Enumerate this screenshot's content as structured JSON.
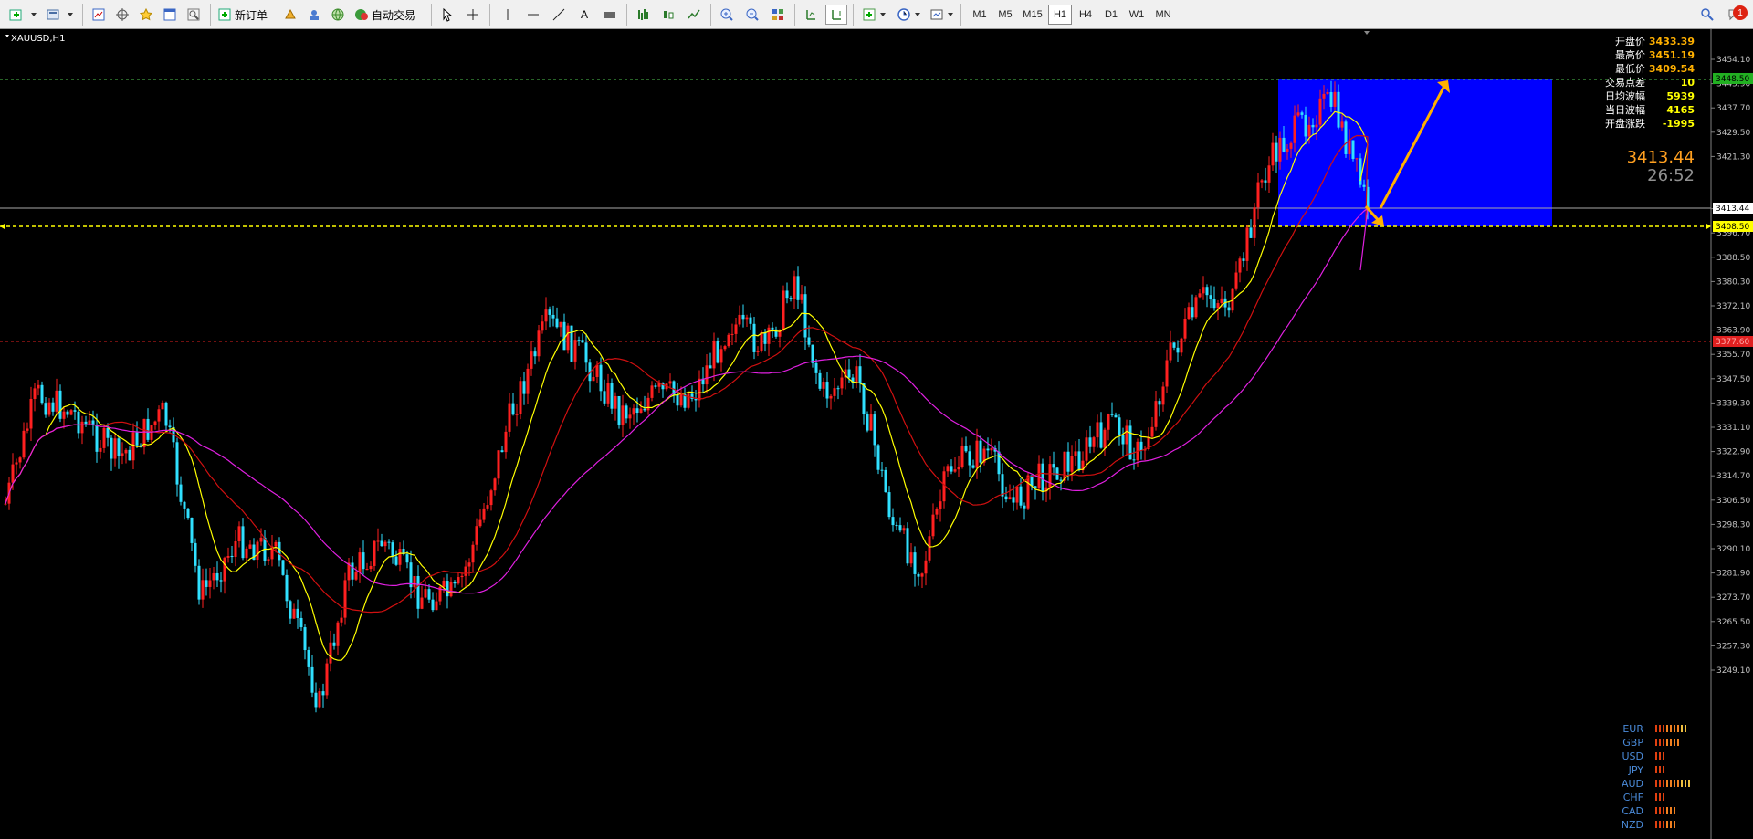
{
  "toolbar": {
    "new_order": "新订单",
    "auto_trade": "自动交易",
    "timeframes": [
      "M1",
      "M5",
      "M15",
      "H1",
      "H4",
      "D1",
      "W1",
      "MN"
    ],
    "active_timeframe": "H1",
    "notification_count": "1"
  },
  "chart": {
    "symbol_label": "XAUUSD,H1",
    "price_axis_ticks": [
      "3454.10",
      "3445.90",
      "3437.70",
      "3429.50",
      "3421.30",
      "3413.44",
      "3404.90",
      "3396.70",
      "3388.50",
      "3380.30",
      "3372.10",
      "3363.90",
      "3355.70",
      "3347.50",
      "3339.30",
      "3331.10",
      "3322.90",
      "3314.70",
      "3306.50",
      "3298.30",
      "3290.10",
      "3281.90",
      "3273.70",
      "3265.50",
      "3257.30",
      "3249.10"
    ],
    "level_labels": {
      "top": "3448.50",
      "current": "3413.44",
      "support": "3408.50",
      "red": "3377.60"
    },
    "colors": {
      "candle_up": "#ff2020",
      "candle_down": "#30e0ff",
      "ma_yellow": "#ffff00",
      "ma_red": "#d01010",
      "ma_magenta": "#e020e0",
      "box": "#0000ff",
      "arrow": "#ffb000"
    }
  },
  "info_panel": {
    "rows": [
      {
        "label": "开盘价",
        "value": "3433.39"
      },
      {
        "label": "最高价",
        "value": "3451.19"
      },
      {
        "label": "最低价",
        "value": "3409.54"
      },
      {
        "label": "交易点差",
        "value": "10"
      },
      {
        "label": "日均波幅",
        "value": "5939"
      },
      {
        "label": "当日波幅",
        "value": "4165"
      },
      {
        "label": "开盘涨跌",
        "value": "-1995"
      }
    ],
    "current_price": "3413.44",
    "countdown": "26:52"
  },
  "currency_strength": [
    {
      "code": "EUR",
      "bars": 9
    },
    {
      "code": "GBP",
      "bars": 7
    },
    {
      "code": "USD",
      "bars": 3
    },
    {
      "code": "JPY",
      "bars": 3
    },
    {
      "code": "AUD",
      "bars": 10
    },
    {
      "code": "CHF",
      "bars": 3
    },
    {
      "code": "CAD",
      "bars": 6
    },
    {
      "code": "NZD",
      "bars": 6
    }
  ]
}
